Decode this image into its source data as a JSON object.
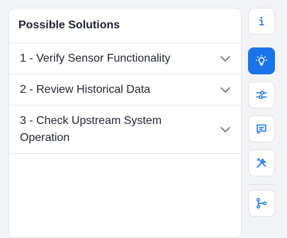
{
  "panel": {
    "title": "Possible Solutions",
    "items": [
      {
        "label": "1 - Verify Sensor Functionality"
      },
      {
        "label": "2 - Review Historical Data"
      },
      {
        "label": "3 - Check Upstream System Operation"
      }
    ]
  },
  "rail": {
    "buttons": [
      {
        "icon": "info-icon",
        "active": false
      },
      {
        "icon": "lightbulb-icon",
        "active": true
      },
      {
        "icon": "sliders-icon",
        "active": false
      },
      {
        "icon": "chat-icon",
        "active": false
      },
      {
        "icon": "tools-icon",
        "active": false
      },
      {
        "icon": "branch-icon",
        "active": false
      }
    ]
  },
  "colors": {
    "accent": "#1a73e8",
    "text": "#1f2430",
    "border": "#e3e5e8",
    "background": "#f2f3f5"
  }
}
